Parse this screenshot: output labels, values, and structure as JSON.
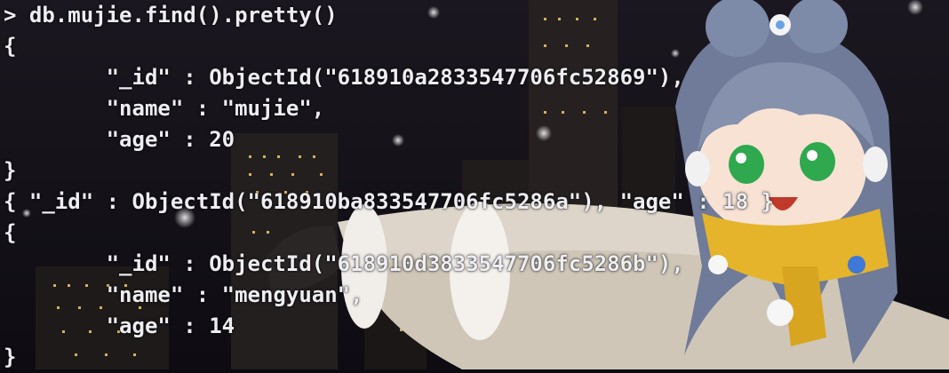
{
  "terminal": {
    "prompt_symbol": ">",
    "command": "db.mujie.find().pretty()",
    "lines": [
      "{",
      "        \"_id\" : ObjectId(\"618910a2833547706fc52869\"),",
      "        \"name\" : \"mujie\",",
      "        \"age\" : 20",
      "}",
      "{ \"_id\" : ObjectId(\"618910ba833547706fc5286a\"), \"age\" : 18 }",
      "{",
      "        \"_id\" : ObjectId(\"618910d3833547706fc5286b\"),",
      "        \"name\" : \"mengyuan\",",
      "        \"age\" : 14",
      "}"
    ]
  },
  "wallpaper": {
    "subject": "anime girl with yellow scarf in snowy night city",
    "colors": {
      "sky": "#121018",
      "building": "#24201f",
      "window_light": "#f3c96a",
      "hair": "#7d8aa8",
      "scarf": "#e5b42a",
      "eyes": "#2fa84e",
      "sleeve": "#d9d0c4"
    }
  }
}
